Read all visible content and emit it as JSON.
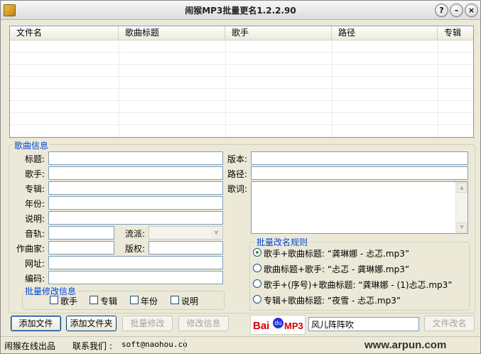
{
  "window": {
    "title": "闹猴MP3批量更名1.2.2.90"
  },
  "titlebar_buttons": {
    "help": "?",
    "minimize": "–",
    "close": "×"
  },
  "list": {
    "columns": [
      "文件名",
      "歌曲标题",
      "歌手",
      "路径",
      "专辑"
    ],
    "rows": []
  },
  "song_info": {
    "legend": "歌曲信息",
    "fields": {
      "title": {
        "label": "标题:",
        "value": ""
      },
      "artist": {
        "label": "歌手:",
        "value": ""
      },
      "album": {
        "label": "专辑:",
        "value": ""
      },
      "year": {
        "label": "年份:",
        "value": ""
      },
      "note": {
        "label": "说明:",
        "value": ""
      },
      "track": {
        "label": "音轨:",
        "value": ""
      },
      "genre": {
        "label": "流派:",
        "value": ""
      },
      "composer": {
        "label": "作曲家:",
        "value": ""
      },
      "copyright": {
        "label": "版权:",
        "value": ""
      },
      "url": {
        "label": "网址:",
        "value": ""
      },
      "encoder": {
        "label": "编码:",
        "value": ""
      },
      "version": {
        "label": "版本:",
        "value": ""
      },
      "path": {
        "label": "路径:",
        "value": ""
      },
      "lyrics": {
        "label": "歌词:",
        "value": ""
      }
    }
  },
  "batch_edit": {
    "legend": "批量修改信息",
    "options": [
      "歌手",
      "专辑",
      "年份",
      "说明"
    ]
  },
  "rename_rules": {
    "legend": "批量改名规则",
    "options": [
      {
        "label": "歌手+歌曲标题:  “龚琳娜 - 忐忑.mp3”",
        "selected": true
      },
      {
        "label": "歌曲标题+歌手:  “忐忑 - 龚琳娜.mp3”",
        "selected": false
      },
      {
        "label": "歌手+(序号)+歌曲标题:  “龚琳娜 - (1)忐忑.mp3”",
        "selected": false
      },
      {
        "label": "专辑+歌曲标题:  “夜雪 - 忐忑.mp3”",
        "selected": false
      }
    ]
  },
  "buttons": {
    "add_file": "添加文件",
    "add_folder": "添加文件夹",
    "batch_modify": "批量修改",
    "modify_info": "修改信息",
    "rename_files": "文件改名"
  },
  "baidu": {
    "logo_text": "Bai",
    "logo_paw": "du",
    "logo_suffix": "MP3",
    "search_value": "风儿阵阵吹"
  },
  "status": {
    "company": "闹猴在线出品",
    "contact_label": "联系我们 :",
    "contact_email": "soft@naohou.co",
    "watermark": "www.arpun.com"
  },
  "colors": {
    "accent": "#0046d5",
    "button_border": "#003c74",
    "input_border": "#7f9db9"
  }
}
